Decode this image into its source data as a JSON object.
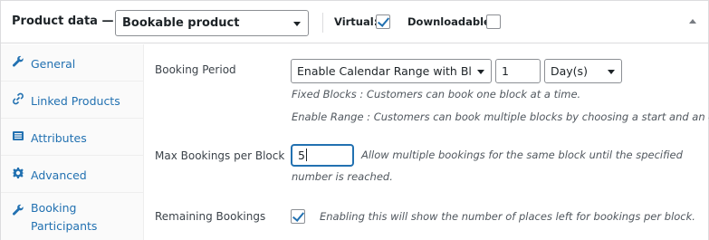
{
  "header": {
    "title": "Product data —",
    "product_type": "Bookable product",
    "virtual_label": "Virtual:",
    "virtual_checked": true,
    "downloadable_label": "Downloadable:",
    "downloadable_checked": false
  },
  "sidebar": {
    "items": [
      {
        "label": "General",
        "icon": "wrench-icon"
      },
      {
        "label": "Linked Products",
        "icon": "link-icon"
      },
      {
        "label": "Attributes",
        "icon": "list-icon"
      },
      {
        "label": "Advanced",
        "icon": "gear-icon"
      },
      {
        "label": "Booking",
        "label2": "Participants",
        "icon": "wrench-icon"
      }
    ]
  },
  "booking_period": {
    "label": "Booking Period",
    "mode_value": "Enable Calendar Range with Bl",
    "number_value": "1",
    "unit_value": "Day(s)",
    "desc_fixed": "Fixed Blocks : Customers can book one block at a time.",
    "desc_range": "Enable Range : Customers can book multiple blocks by choosing a start and an end."
  },
  "max_bookings": {
    "label": "Max Bookings per Block",
    "value": "5",
    "desc_line1": "Allow multiple bookings for the same block until the specified",
    "desc_line2": "number is reached."
  },
  "remaining": {
    "label": "Remaining Bookings",
    "checked": true,
    "desc": "Enabling this will show the number of places left for bookings per block."
  },
  "colors": {
    "accent": "#2271b1",
    "border": "#dcdcde",
    "sidebar_bg": "#fafafa"
  }
}
